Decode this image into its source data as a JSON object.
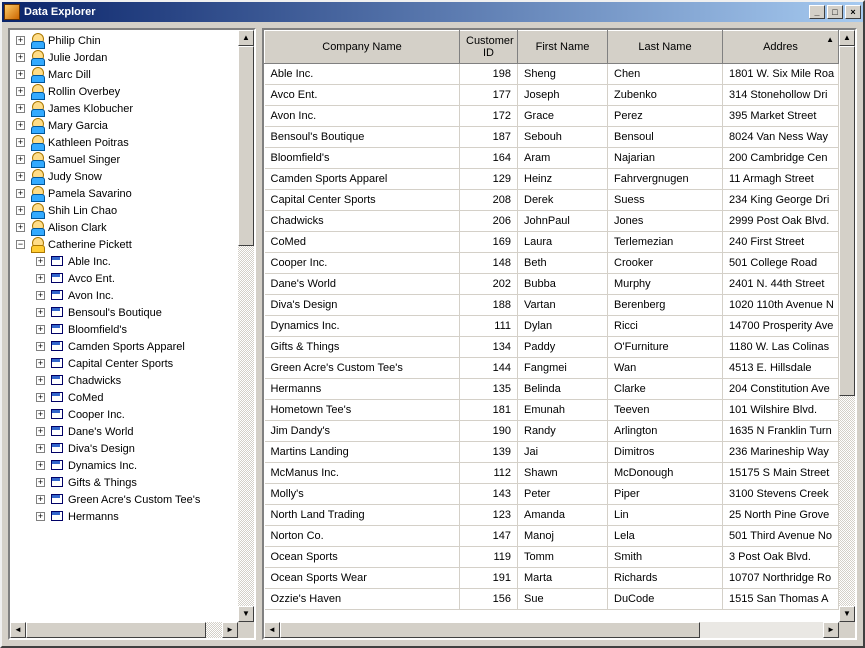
{
  "window": {
    "title": "Data Explorer",
    "btn_min": "_",
    "btn_max": "□",
    "btn_close": "×"
  },
  "scroll": {
    "up": "▲",
    "down": "▼",
    "left": "◄",
    "right": "►"
  },
  "tree": {
    "people": [
      "Philip  Chin",
      "Julie  Jordan",
      "Marc  Dill",
      "Rollin  Overbey",
      "James  Klobucher",
      "Mary  Garcia",
      "Kathleen  Poitras",
      "Samuel  Singer",
      "Judy  Snow",
      "Pamela  Savarino",
      "Shih Lin  Chao",
      "Alison  Clark"
    ],
    "selected": "Catherine  Pickett",
    "companies": [
      "Able Inc.",
      "Avco Ent.",
      "Avon Inc.",
      "Bensoul's Boutique",
      "Bloomfield's",
      "Camden Sports Apparel",
      "Capital Center Sports",
      "Chadwicks",
      "CoMed",
      "Cooper Inc.",
      "Dane's World",
      "Diva's Design",
      "Dynamics Inc.",
      "Gifts & Things",
      "Green Acre's Custom Tee's",
      "Hermanns"
    ]
  },
  "grid": {
    "headers": {
      "company": "Company Name",
      "custid": "Customer ID",
      "fname": "First Name",
      "lname": "Last Name",
      "address": "Addres"
    },
    "rows": [
      {
        "company": "Able Inc.",
        "custid": 198,
        "fname": "Sheng",
        "lname": "Chen",
        "address": "1801 W. Six Mile Roa"
      },
      {
        "company": "Avco Ent.",
        "custid": 177,
        "fname": "Joseph",
        "lname": "Zubenko",
        "address": "314 Stonehollow Dri"
      },
      {
        "company": "Avon Inc.",
        "custid": 172,
        "fname": "Grace",
        "lname": "Perez",
        "address": "395 Market Street"
      },
      {
        "company": "Bensoul's Boutique",
        "custid": 187,
        "fname": "Sebouh",
        "lname": "Bensoul",
        "address": "8024 Van Ness Way"
      },
      {
        "company": "Bloomfield's",
        "custid": 164,
        "fname": "Aram",
        "lname": "Najarian",
        "address": "200 Cambridge Cen"
      },
      {
        "company": "Camden Sports Apparel",
        "custid": 129,
        "fname": "Heinz",
        "lname": "Fahrvergnugen",
        "address": "11 Armagh Street"
      },
      {
        "company": "Capital Center Sports",
        "custid": 208,
        "fname": "Derek",
        "lname": "Suess",
        "address": "234 King George Dri"
      },
      {
        "company": "Chadwicks",
        "custid": 206,
        "fname": "JohnPaul",
        "lname": "Jones",
        "address": "2999 Post Oak Blvd."
      },
      {
        "company": "CoMed",
        "custid": 169,
        "fname": "Laura",
        "lname": "Terlemezian",
        "address": "240 First Street"
      },
      {
        "company": "Cooper Inc.",
        "custid": 148,
        "fname": "Beth",
        "lname": "Crooker",
        "address": "501 College Road"
      },
      {
        "company": "Dane's World",
        "custid": 202,
        "fname": "Bubba",
        "lname": "Murphy",
        "address": "2401 N. 44th Street"
      },
      {
        "company": "Diva's Design",
        "custid": 188,
        "fname": "Vartan",
        "lname": "Berenberg",
        "address": "1020 110th Avenue N"
      },
      {
        "company": "Dynamics Inc.",
        "custid": 111,
        "fname": "Dylan",
        "lname": "Ricci",
        "address": "14700 Prosperity Ave"
      },
      {
        "company": "Gifts & Things",
        "custid": 134,
        "fname": "Paddy",
        "lname": "O'Furniture",
        "address": "1180 W. Las Colinas"
      },
      {
        "company": "Green Acre's Custom Tee's",
        "custid": 144,
        "fname": "Fangmei",
        "lname": "Wan",
        "address": "4513 E. Hillsdale"
      },
      {
        "company": "Hermanns",
        "custid": 135,
        "fname": "Belinda",
        "lname": "Clarke",
        "address": "204 Constitution Ave"
      },
      {
        "company": "Hometown Tee's",
        "custid": 181,
        "fname": "Emunah",
        "lname": "Teeven",
        "address": "101 Wilshire Blvd."
      },
      {
        "company": "Jim Dandy's",
        "custid": 190,
        "fname": "Randy",
        "lname": "Arlington",
        "address": "1635 N Franklin Turn"
      },
      {
        "company": "Martins Landing",
        "custid": 139,
        "fname": "Jai",
        "lname": "Dimitros",
        "address": "236 Marineship Way"
      },
      {
        "company": "McManus Inc.",
        "custid": 112,
        "fname": "Shawn",
        "lname": "McDonough",
        "address": "15175 S Main Street"
      },
      {
        "company": "Molly's",
        "custid": 143,
        "fname": "Peter",
        "lname": "Piper",
        "address": "3100 Stevens Creek"
      },
      {
        "company": "North Land Trading",
        "custid": 123,
        "fname": "Amanda",
        "lname": "Lin",
        "address": "25 North Pine Grove"
      },
      {
        "company": "Norton Co.",
        "custid": 147,
        "fname": "Manoj",
        "lname": "Lela",
        "address": "501 Third Avenue No"
      },
      {
        "company": "Ocean Sports",
        "custid": 119,
        "fname": "Tomm",
        "lname": "Smith",
        "address": "3 Post Oak Blvd."
      },
      {
        "company": "Ocean Sports Wear",
        "custid": 191,
        "fname": "Marta",
        "lname": "Richards",
        "address": "10707 Northridge Ro"
      },
      {
        "company": "Ozzie's Haven",
        "custid": 156,
        "fname": "Sue",
        "lname": "DuCode",
        "address": "1515 San Thomas A"
      }
    ]
  }
}
